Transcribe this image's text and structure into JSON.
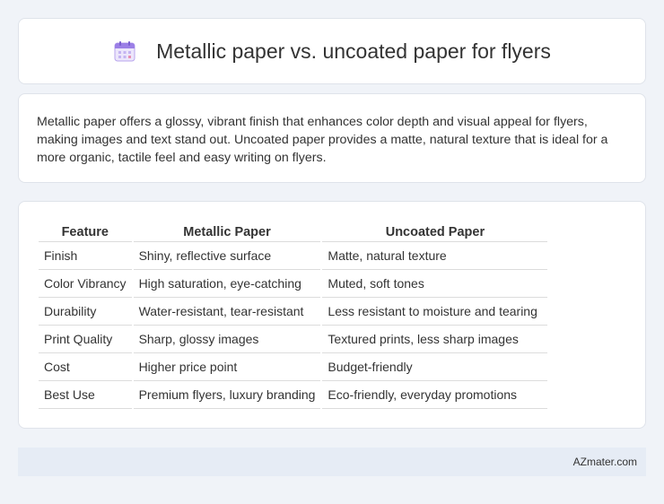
{
  "header": {
    "title": "Metallic paper vs. uncoated paper for flyers",
    "icon": "calendar-icon"
  },
  "summary": {
    "text": "Metallic paper offers a glossy, vibrant finish that enhances color depth and visual appeal for flyers, making images and text stand out. Uncoated paper provides a matte, natural texture that is ideal for a more organic, tactile feel and easy writing on flyers."
  },
  "table": {
    "headers": [
      "Feature",
      "Metallic Paper",
      "Uncoated Paper"
    ],
    "rows": [
      [
        "Finish",
        "Shiny, reflective surface",
        "Matte, natural texture"
      ],
      [
        "Color Vibrancy",
        "High saturation, eye-catching",
        "Muted, soft tones"
      ],
      [
        "Durability",
        "Water-resistant, tear-resistant",
        "Less resistant to moisture and tearing"
      ],
      [
        "Print Quality",
        "Sharp, glossy images",
        "Textured prints, less sharp images"
      ],
      [
        "Cost",
        "Higher price point",
        "Budget-friendly"
      ],
      [
        "Best Use",
        "Premium flyers, luxury branding",
        "Eco-friendly, everyday promotions"
      ]
    ]
  },
  "footer": {
    "text": "AZmater.com"
  },
  "colors": {
    "page_background": "#f0f3f8",
    "card_background": "#ffffff",
    "footer_background": "#e6ecf5",
    "icon_accent": "#9b7fe6"
  }
}
